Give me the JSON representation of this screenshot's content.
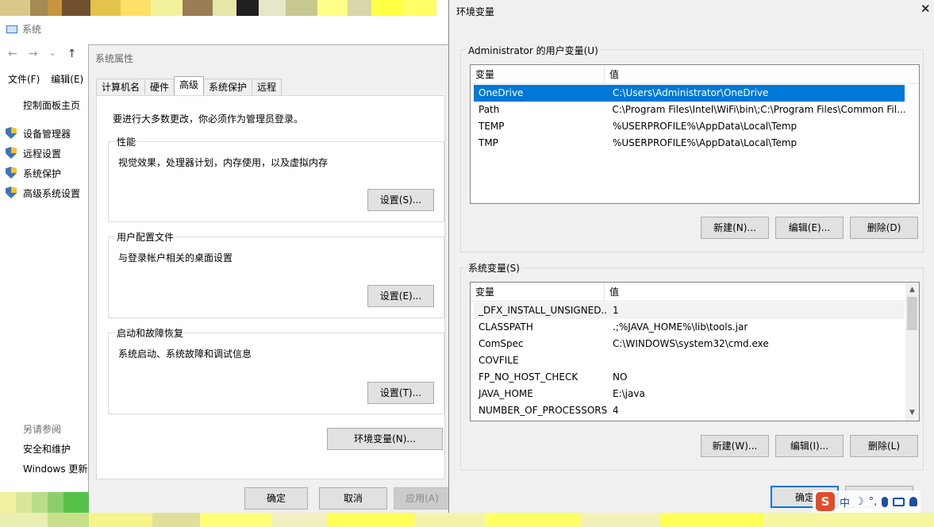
{
  "background_window": {
    "title": "系统",
    "nav": {
      "back": "←",
      "forward": "→",
      "dropdown": "⌄",
      "up": "↑"
    },
    "menu": [
      "文件(F)",
      "编辑(E)"
    ],
    "control_panel_home": "控制面板主页",
    "links": [
      "设备管理器",
      "远程设置",
      "系统保护",
      "高级系统设置"
    ],
    "see_also": "另请参阅",
    "bottom_links": [
      "安全和维护",
      "Windows 更新"
    ]
  },
  "system_properties": {
    "title": "系统属性",
    "tabs": [
      "计算机名",
      "硬件",
      "高级",
      "系统保护",
      "远程"
    ],
    "active_tab": "高级",
    "admin_note": "要进行大多数更改，你必须作为管理员登录。",
    "groups": [
      {
        "label": "性能",
        "description": "视觉效果，处理器计划，内存使用，以及虚拟内存",
        "button": "设置(S)..."
      },
      {
        "label": "用户配置文件",
        "description": "与登录帐户相关的桌面设置",
        "button": "设置(E)..."
      },
      {
        "label": "启动和故障恢复",
        "description": "系统启动、系统故障和调试信息",
        "button": "设置(T)..."
      }
    ],
    "env_button": "环境变量(N)...",
    "ok": "确定",
    "cancel": "取消",
    "apply": "应用(A)"
  },
  "environment_variables": {
    "title": "环境变量",
    "close": "✕",
    "user_section_label": "Administrator 的用户变量(U)",
    "columns": [
      "变量",
      "值"
    ],
    "user_vars": [
      {
        "name": "OneDrive",
        "value": "C:\\Users\\Administrator\\OneDrive",
        "selected": true
      },
      {
        "name": "Path",
        "value": "C:\\Program Files\\Intel\\WiFi\\bin\\;C:\\Program Files\\Common Fil...",
        "selected": false
      },
      {
        "name": "TEMP",
        "value": "%USERPROFILE%\\AppData\\Local\\Temp",
        "selected": false
      },
      {
        "name": "TMP",
        "value": "%USERPROFILE%\\AppData\\Local\\Temp",
        "selected": false
      }
    ],
    "user_buttons": {
      "new": "新建(N)...",
      "edit": "编辑(E)...",
      "delete": "删除(D)"
    },
    "system_section_label": "系统变量(S)",
    "system_vars": [
      {
        "name": "_DFX_INSTALL_UNSIGNED...",
        "value": "1"
      },
      {
        "name": "CLASSPATH",
        "value": ".;%JAVA_HOME%\\lib\\tools.jar"
      },
      {
        "name": "ComSpec",
        "value": "C:\\WINDOWS\\system32\\cmd.exe"
      },
      {
        "name": "COVFILE",
        "value": ""
      },
      {
        "name": "FP_NO_HOST_CHECK",
        "value": "NO"
      },
      {
        "name": "JAVA_HOME",
        "value": "E:\\java"
      },
      {
        "name": "NUMBER_OF_PROCESSORS",
        "value": "4"
      }
    ],
    "system_buttons": {
      "new": "新建(W)...",
      "edit": "编辑(I)...",
      "delete": "删除(L)"
    },
    "ok": "确定"
  },
  "tray": {
    "ime_logo": "S",
    "ime_mode": "中",
    "punct": "°,",
    "moon": "☽"
  },
  "colors": {
    "selection": "#0078d7",
    "dialog_bg": "#f0f0f0",
    "button_bg": "#e1e1e1"
  }
}
